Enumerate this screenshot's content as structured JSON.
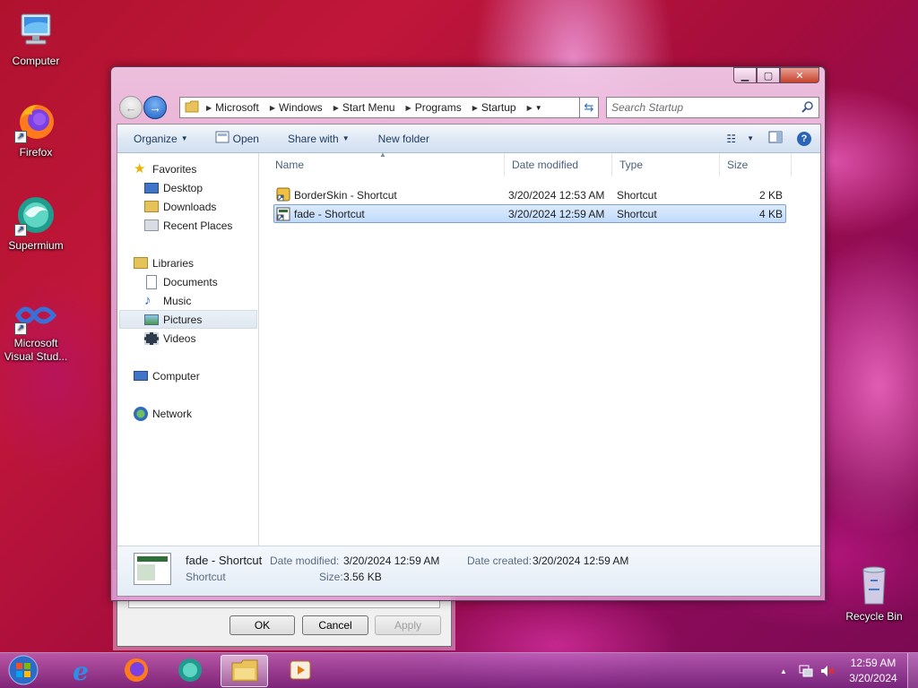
{
  "desktop": {
    "icons": [
      {
        "label": "Computer"
      },
      {
        "label": "Firefox"
      },
      {
        "label": "Supermium"
      },
      {
        "label": "Microsoft Visual Stud..."
      },
      {
        "label": "Recycle Bin"
      }
    ]
  },
  "back_dialog": {
    "ok": "OK",
    "cancel": "Cancel",
    "apply": "Apply"
  },
  "explorer": {
    "breadcrumb": [
      "Microsoft",
      "Windows",
      "Start Menu",
      "Programs",
      "Startup"
    ],
    "search_placeholder": "Search Startup",
    "toolbar": {
      "organize": "Organize",
      "open": "Open",
      "share_with": "Share with",
      "new_folder": "New folder"
    },
    "nav": {
      "favorites": "Favorites",
      "desktop": "Desktop",
      "downloads": "Downloads",
      "recent_places": "Recent Places",
      "libraries": "Libraries",
      "documents": "Documents",
      "music": "Music",
      "pictures": "Pictures",
      "videos": "Videos",
      "computer": "Computer",
      "network": "Network"
    },
    "columns": {
      "name": "Name",
      "date_modified": "Date modified",
      "type": "Type",
      "size": "Size"
    },
    "files": [
      {
        "name": "BorderSkin - Shortcut",
        "date": "3/20/2024 12:53 AM",
        "type": "Shortcut",
        "size": "2 KB",
        "selected": false
      },
      {
        "name": "fade - Shortcut",
        "date": "3/20/2024 12:59 AM",
        "type": "Shortcut",
        "size": "4 KB",
        "selected": true
      }
    ],
    "details": {
      "name": "fade - Shortcut",
      "type": "Shortcut",
      "date_modified_label": "Date modified:",
      "date_modified": "3/20/2024 12:59 AM",
      "size_label": "Size:",
      "size": "3.56 KB",
      "date_created_label": "Date created:",
      "date_created": "3/20/2024 12:59 AM"
    }
  },
  "taskbar": {
    "time": "12:59 AM",
    "date": "3/20/2024"
  },
  "colors": {
    "accent": "#1d5fc7",
    "selection": "#c1dbfc",
    "close_button": "#c8432b"
  }
}
